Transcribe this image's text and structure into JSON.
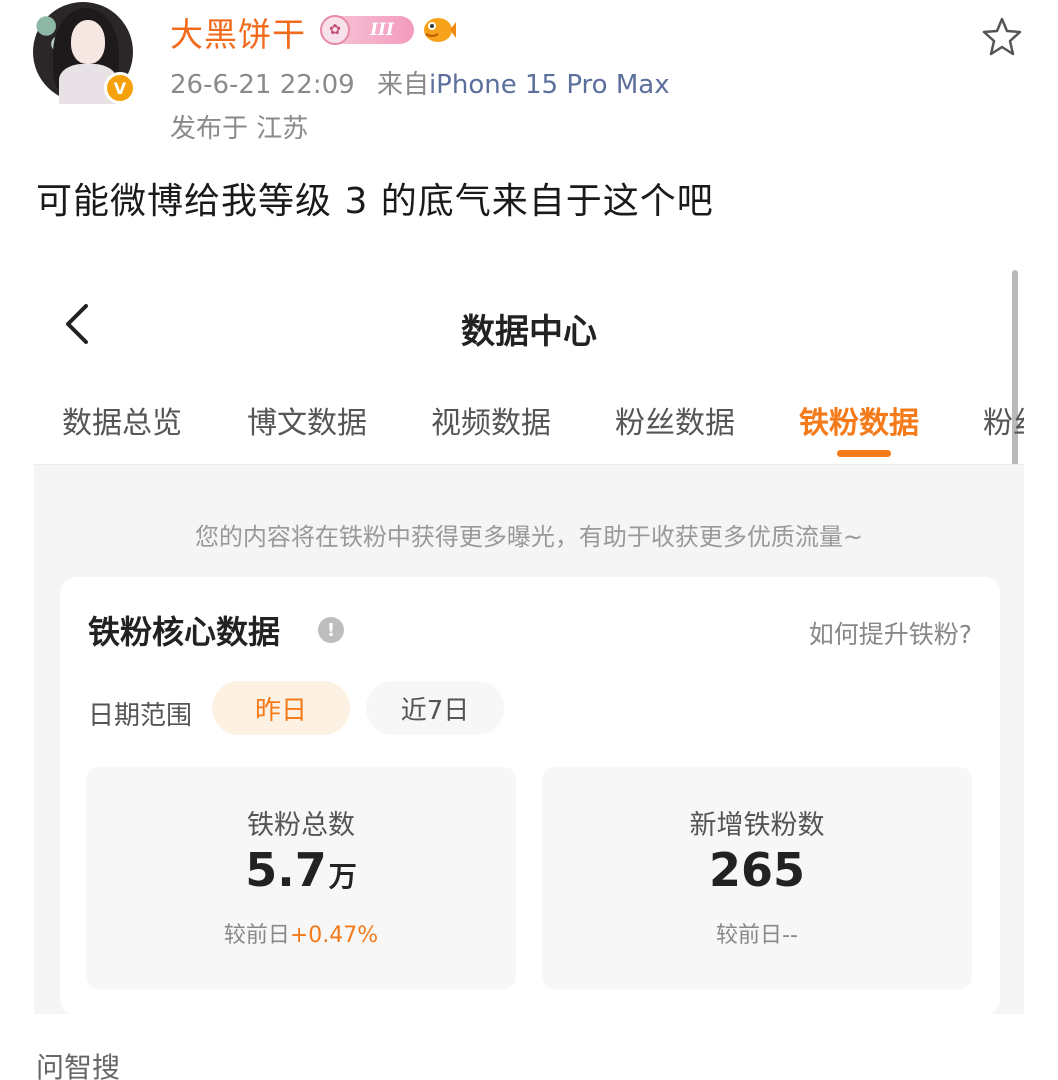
{
  "post": {
    "username": "大黑饼干",
    "level_badge": "III",
    "timestamp": "26-6-21 22:09",
    "source_prefix": "来自",
    "device": "iPhone 15 Pro Max",
    "location": "发布于 江苏",
    "text": "可能微博给我等级 3 的底气来自于这个吧",
    "footer": "问智搜"
  },
  "screenshot": {
    "title": "数据中心",
    "tabs": [
      "数据总览",
      "博文数据",
      "视频数据",
      "粉丝数据",
      "铁粉数据",
      "粉丝"
    ],
    "active_tab_index": 4,
    "notice": "您的内容将在铁粉中获得更多曝光，有助于收获更多优质流量~",
    "card": {
      "title": "铁粉核心数据",
      "info_glyph": "!",
      "help_link": "如何提升铁粉?",
      "date_range_label": "日期范围",
      "date_options": [
        "昨日",
        "近7日"
      ],
      "selected_date_option": "昨日",
      "stats": [
        {
          "label": "铁粉总数",
          "value": "5.7",
          "unit": "万",
          "compare_prefix": "较前日",
          "compare_value": "+0.47%"
        },
        {
          "label": "新增铁粉数",
          "value": "265",
          "unit": "",
          "compare_prefix": "较前日",
          "compare_value": "--"
        }
      ]
    }
  },
  "colors": {
    "accent_orange": "#f47a1a",
    "username_orange": "#f26b1d",
    "device_blue": "#5d6f9c",
    "verified_gold": "#f5a20a"
  },
  "icons": [
    "verified-v-icon",
    "level-badge-icon",
    "fish-icon",
    "star-icon",
    "back-arrow-icon",
    "info-icon"
  ]
}
